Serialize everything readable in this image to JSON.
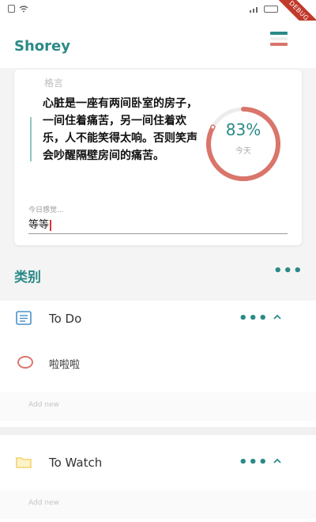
{
  "status_bar": {
    "debug_label": "DEBUG"
  },
  "app_bar": {
    "title": "Shorey",
    "icon": "theme-stripes-icon"
  },
  "quote_card": {
    "label": "格言",
    "quote": "心脏是一座有两间卧室的房子，一间住着痛苦，另一间住着欢乐，人不能笑得太响。否则笑声会吵醒隔壁房间的痛苦。",
    "progress_percent": 83,
    "progress_text": "83%",
    "progress_label": "今天",
    "mood_label": "今日感觉...",
    "mood_value": "等等"
  },
  "categories": {
    "title": "类别",
    "groups": [
      {
        "name": "To Do",
        "icon": "list-icon",
        "tasks": [
          {
            "text": "啦啦啦",
            "done": false
          }
        ],
        "add_label": "Add new"
      },
      {
        "name": "To Watch",
        "icon": "folder-icon",
        "tasks": [],
        "add_label": "Add new"
      }
    ]
  },
  "colors": {
    "accent": "#2a8a87",
    "progress": "#d9756b",
    "folder": "#f3d36b",
    "list": "#4a90c8"
  }
}
